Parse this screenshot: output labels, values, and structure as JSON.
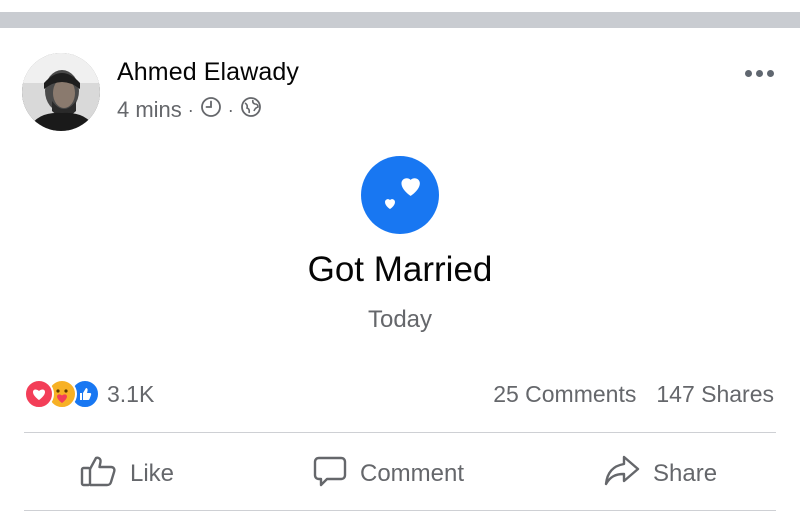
{
  "post": {
    "author": "Ahmed Elawady",
    "time": "4 mins",
    "separator": "·",
    "icons": {
      "clock": "clock-icon",
      "audience": "globe-icon",
      "more": "more-options-icon",
      "event": "hearts-icon"
    },
    "event": {
      "title": "Got Married",
      "date": "Today",
      "icon_color": "#1877f2"
    },
    "reactions": {
      "types": [
        "love",
        "care",
        "like"
      ],
      "count": "3.1K"
    },
    "comments_text": "25 Comments",
    "shares_text": "147 Shares"
  },
  "actions": {
    "like_label": "Like",
    "comment_label": "Comment",
    "share_label": "Share"
  },
  "colors": {
    "brand_blue": "#1877f2",
    "love_red": "#f33e58",
    "care_yellow": "#f7b125",
    "secondary_text": "#65676b"
  }
}
